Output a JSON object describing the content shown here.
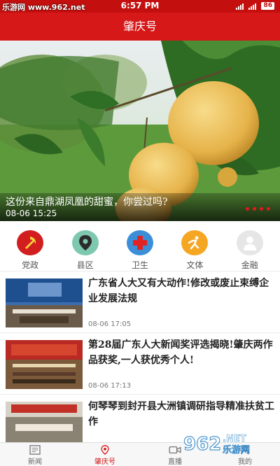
{
  "status_bar": {
    "watermark": "乐游网 www.962.net",
    "time": "6:57 PM",
    "battery": "86"
  },
  "header": {
    "title": "肇庆号"
  },
  "hero": {
    "caption": "这份来自鼎湖凤凰的甜蜜，你尝过吗?",
    "date": "08-06  15:25",
    "page_dots": 4
  },
  "categories": [
    {
      "label": "党政",
      "icon": "party-emblem-icon",
      "color": "#d21e1e"
    },
    {
      "label": "县区",
      "icon": "location-pin-icon",
      "color": "#7ec8b0"
    },
    {
      "label": "卫生",
      "icon": "medical-cross-icon",
      "color": "#3b8fd9"
    },
    {
      "label": "文体",
      "icon": "runner-icon",
      "color": "#f5a623"
    },
    {
      "label": "金融",
      "icon": "person-icon",
      "color": "#e6e6e6"
    }
  ],
  "news": [
    {
      "title": "广东省人大又有大动作!修改或废止束缚企业发展法规",
      "date": "08-06  17:05"
    },
    {
      "title": "第28届广东人大新闻奖评选揭晓!肇庆两作品获奖,一人获优秀个人!",
      "date": "08-06  17:13"
    },
    {
      "title": "何琴琴到封开县大洲镇调研指导精准扶贫工作",
      "date": ""
    }
  ],
  "tabs": [
    {
      "label": "新闻",
      "icon": "newspaper-icon",
      "active": false
    },
    {
      "label": "肇庆号",
      "icon": "location-pin-icon",
      "active": true
    },
    {
      "label": "直播",
      "icon": "video-camera-icon",
      "active": false
    },
    {
      "label": "我的",
      "icon": "person-icon",
      "active": false
    }
  ],
  "corner_watermark": "962.NET 乐游网",
  "colors": {
    "primary": "#d61818",
    "statusbar": "#c40f0f"
  }
}
